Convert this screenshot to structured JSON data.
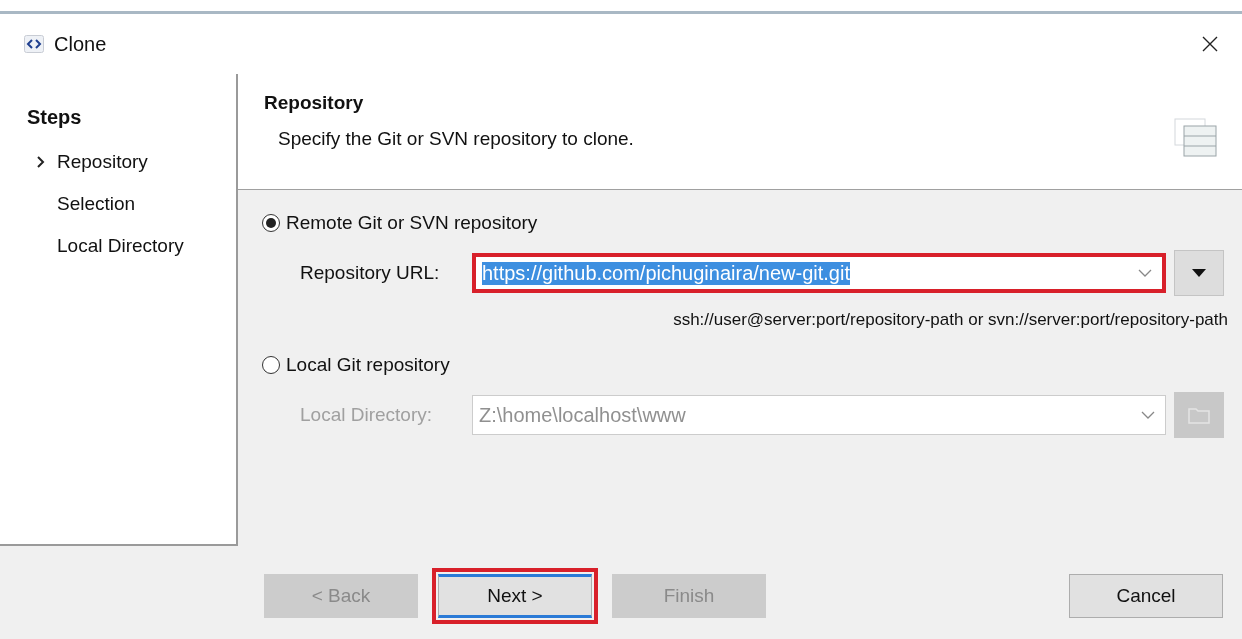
{
  "window": {
    "title": "Clone"
  },
  "steps": {
    "title": "Steps",
    "items": [
      {
        "label": "Repository",
        "selected": true
      },
      {
        "label": "Selection",
        "selected": false
      },
      {
        "label": "Local Directory",
        "selected": false
      }
    ]
  },
  "header": {
    "title": "Repository",
    "description": "Specify the Git or SVN repository to clone."
  },
  "sources": [
    {
      "label": "Remote Git or SVN repository",
      "selected": true,
      "field_label": "Repository URL:",
      "value": "https://github.com/pichuginaira/new-git.git",
      "text_selected": true,
      "highlighted": true,
      "disabled": false,
      "hint": "ssh://user@server:port/repository-path or svn://server:port/repository-path",
      "kind": "url"
    },
    {
      "label": "Local Git repository",
      "selected": false,
      "field_label": "Local Directory:",
      "value": "Z:\\home\\localhost\\www",
      "text_selected": false,
      "highlighted": false,
      "disabled": true,
      "kind": "folder"
    }
  ],
  "buttons": [
    {
      "label": "< Back",
      "disabled": true,
      "highlighted": false
    },
    {
      "label": "Next >",
      "disabled": false,
      "highlighted": true
    },
    {
      "label": "Finish",
      "disabled": true,
      "highlighted": false
    },
    {
      "label": "Cancel",
      "disabled": false,
      "highlighted": false
    }
  ]
}
